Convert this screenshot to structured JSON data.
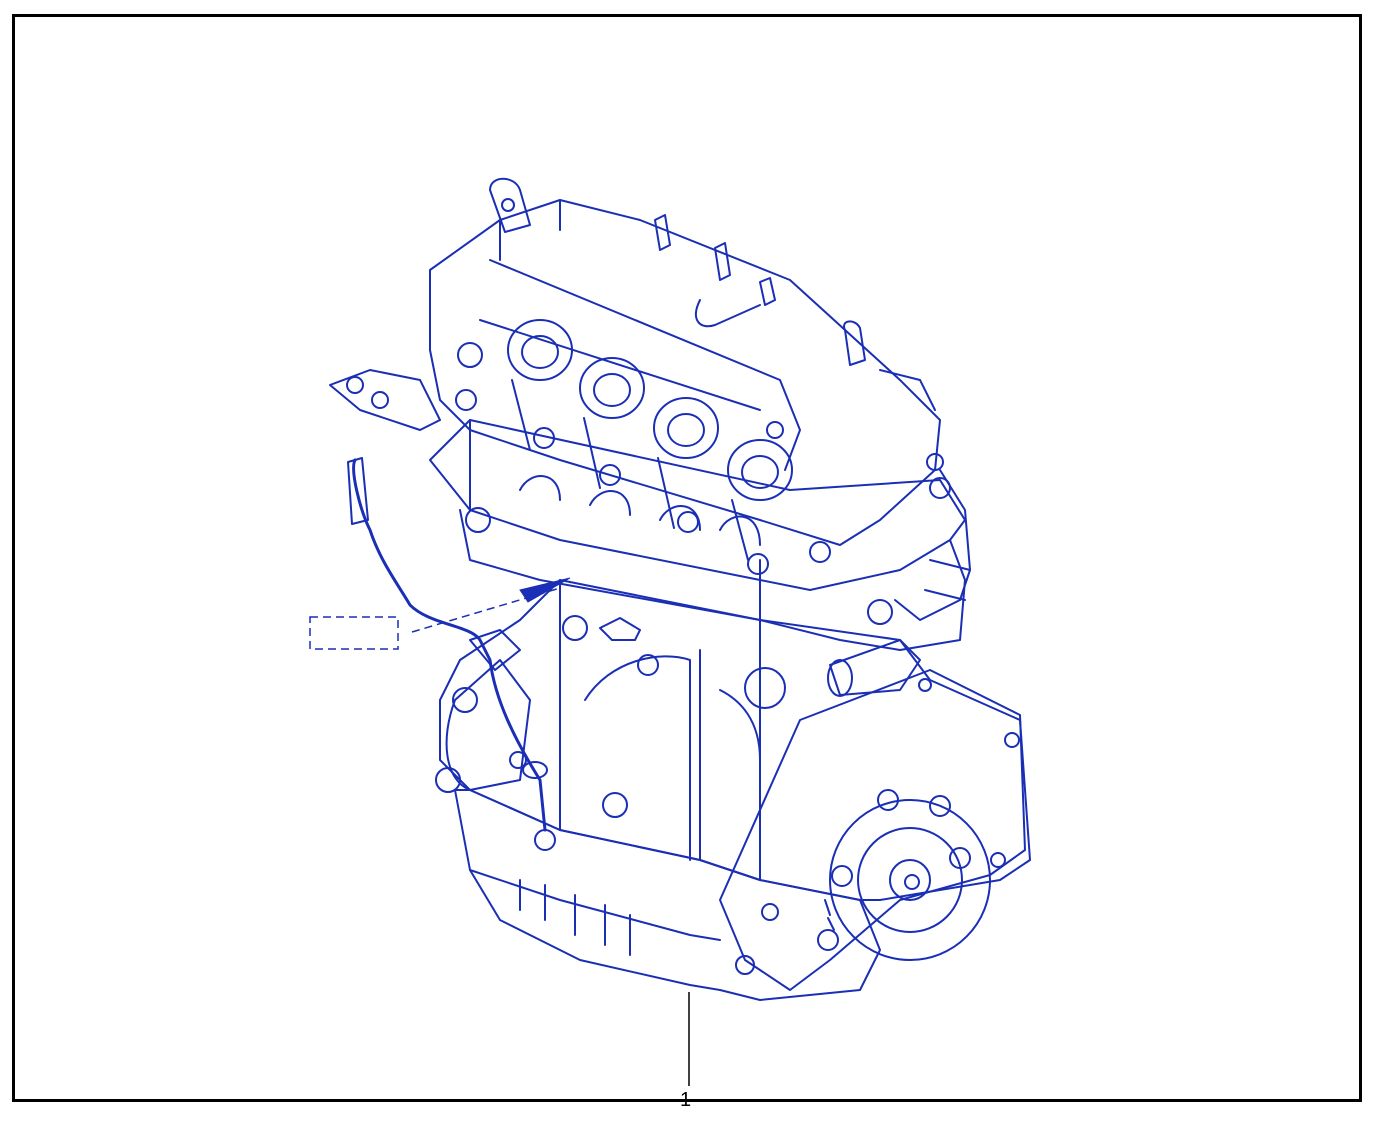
{
  "diagram": {
    "callouts": [
      {
        "number": "1",
        "label_text": "1"
      }
    ],
    "colors": {
      "line_art": "#1a2fb5",
      "frame": "#000000",
      "callout": "#000000",
      "background": "#ffffff"
    }
  }
}
